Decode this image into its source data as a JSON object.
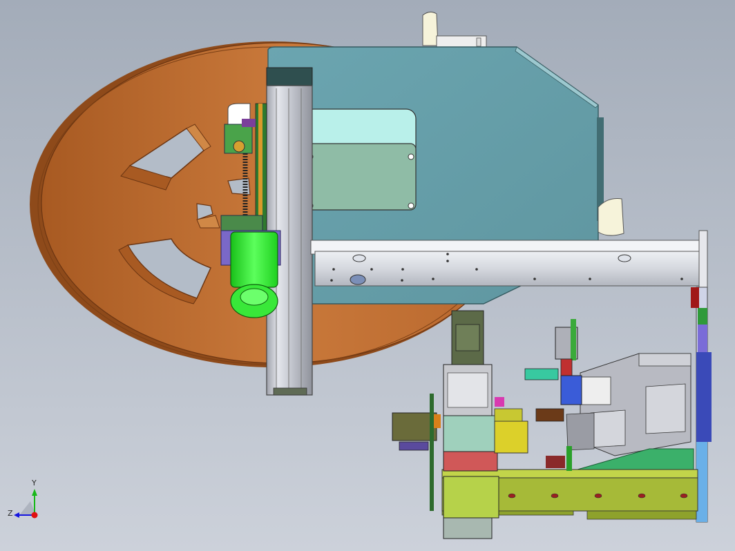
{
  "axis_triad": {
    "y_label": "Y",
    "z_label": "Z",
    "x_color": "#e01010",
    "y_color": "#18b818",
    "z_color": "#1515e0"
  },
  "colors": {
    "background_top": "#a4adba",
    "background_bottom": "#cbd0d9",
    "reel": "#c8783a",
    "reel_dark": "#7a3e12",
    "cabinet": "#6aa0aa",
    "motor": "#3cf53c",
    "lid": "#a8e3dc",
    "frame": "#c8c8d0",
    "base_plate": "#a8be3a"
  }
}
